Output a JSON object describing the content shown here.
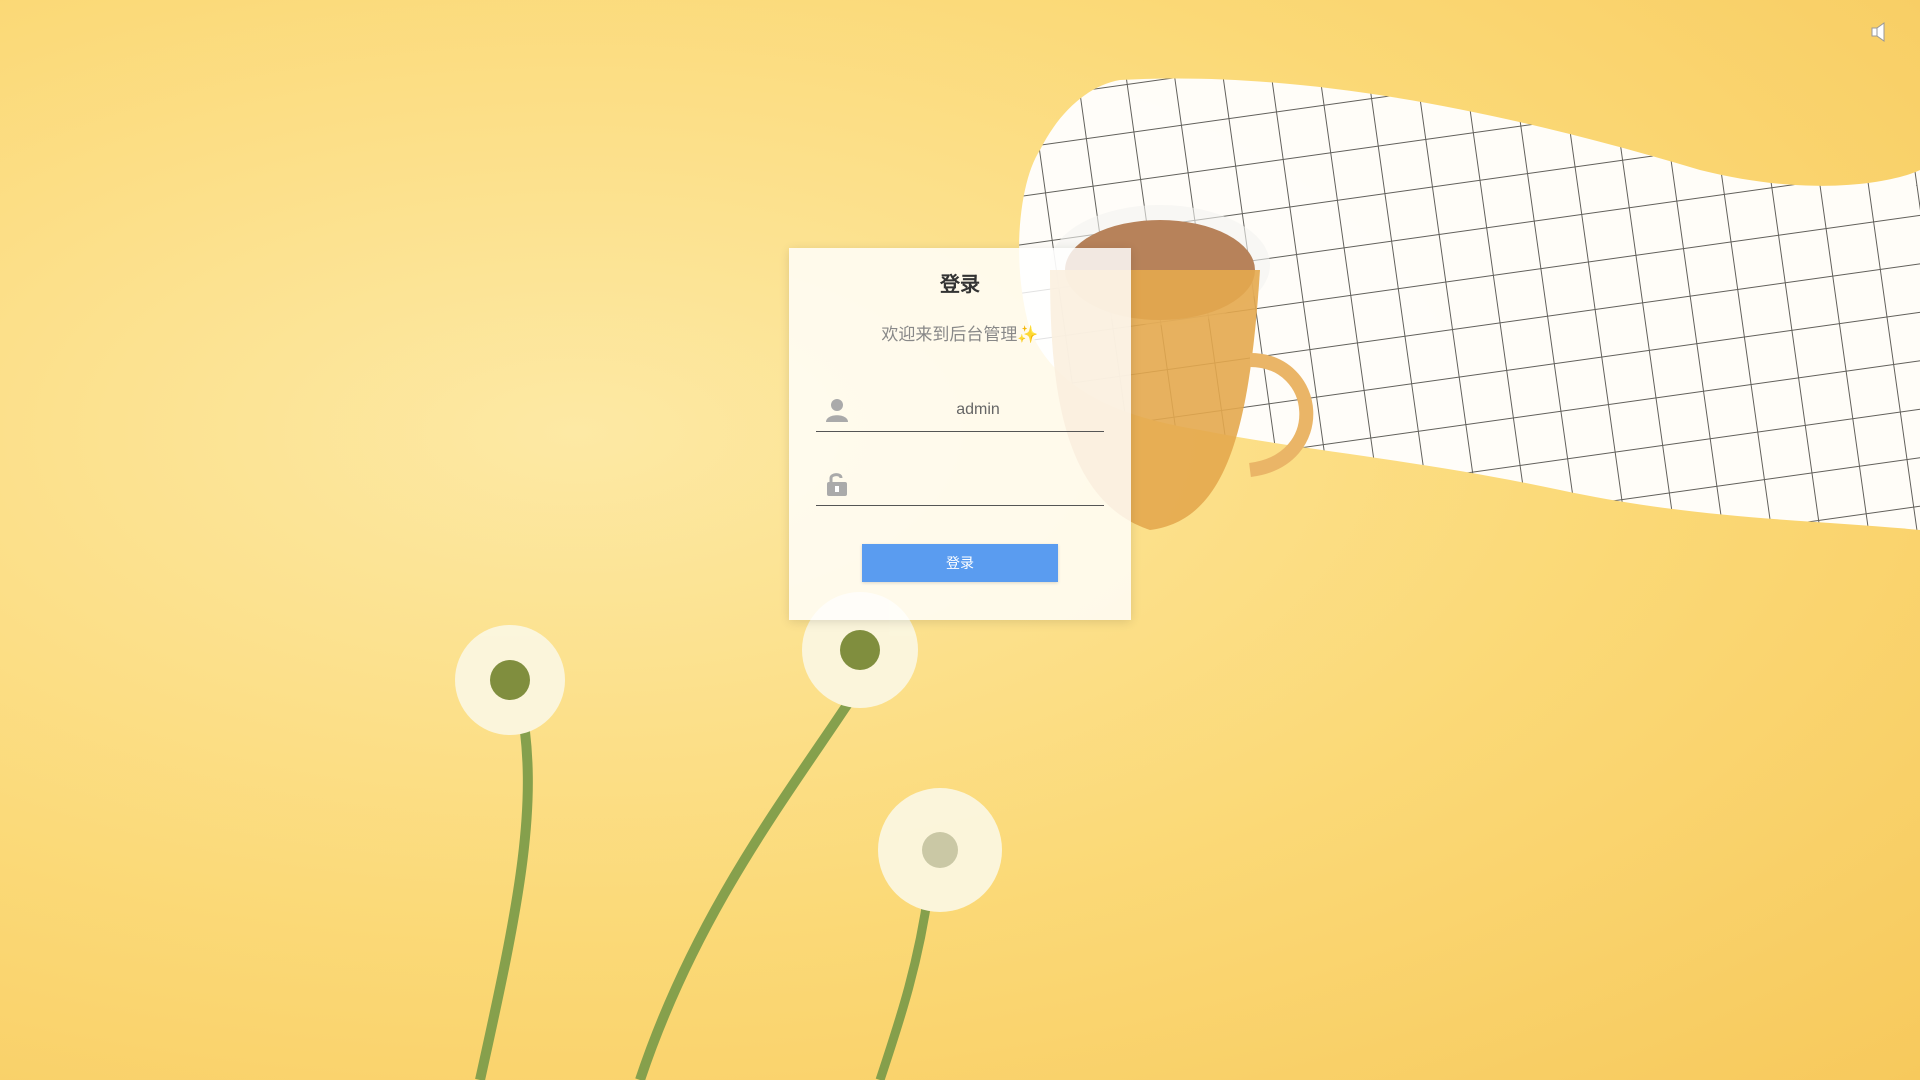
{
  "login": {
    "title": "登录",
    "subtitle": "欢迎来到后台管理✨",
    "username_value": "admin",
    "password_value": "",
    "button_label": "登录"
  },
  "icons": {
    "sound": "speaker-icon",
    "user": "user-icon",
    "lock": "unlocked-lock-icon"
  },
  "colors": {
    "background": "#fbd977",
    "button": "#5a9cf0"
  }
}
